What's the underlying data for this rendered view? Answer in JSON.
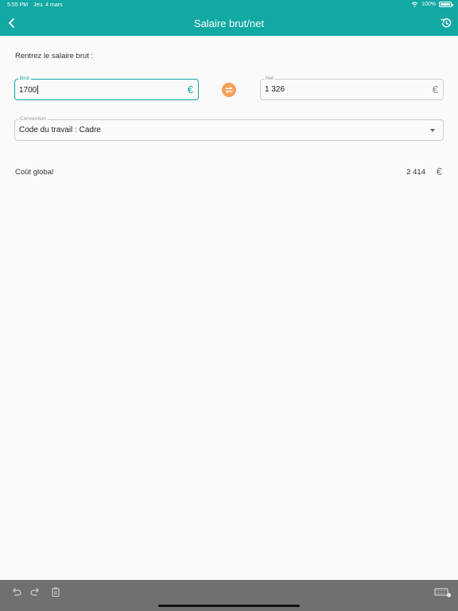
{
  "status_bar": {
    "time": "5:55 PM",
    "date": "Jeu. 4 mars",
    "battery": "100%"
  },
  "nav": {
    "title": "Salaire brut/net",
    "back_icon": "chevron-left-icon",
    "history_icon": "history-icon"
  },
  "form": {
    "prompt": "Rentrez le salaire brut :",
    "brut": {
      "label": "Brut",
      "value": "1700",
      "currency": "€"
    },
    "swap_icon": "swap-arrows-icon",
    "net": {
      "label": "Net",
      "value": "1 326",
      "currency": "€"
    },
    "convention": {
      "label": "Convention",
      "value": "Code du travail : Cadre"
    }
  },
  "result": {
    "label": "Coût global",
    "value": "2 414",
    "currency": "€"
  },
  "colors": {
    "accent": "#12a8a4",
    "swap": "#f5a15a",
    "toolbar": "#707070"
  }
}
